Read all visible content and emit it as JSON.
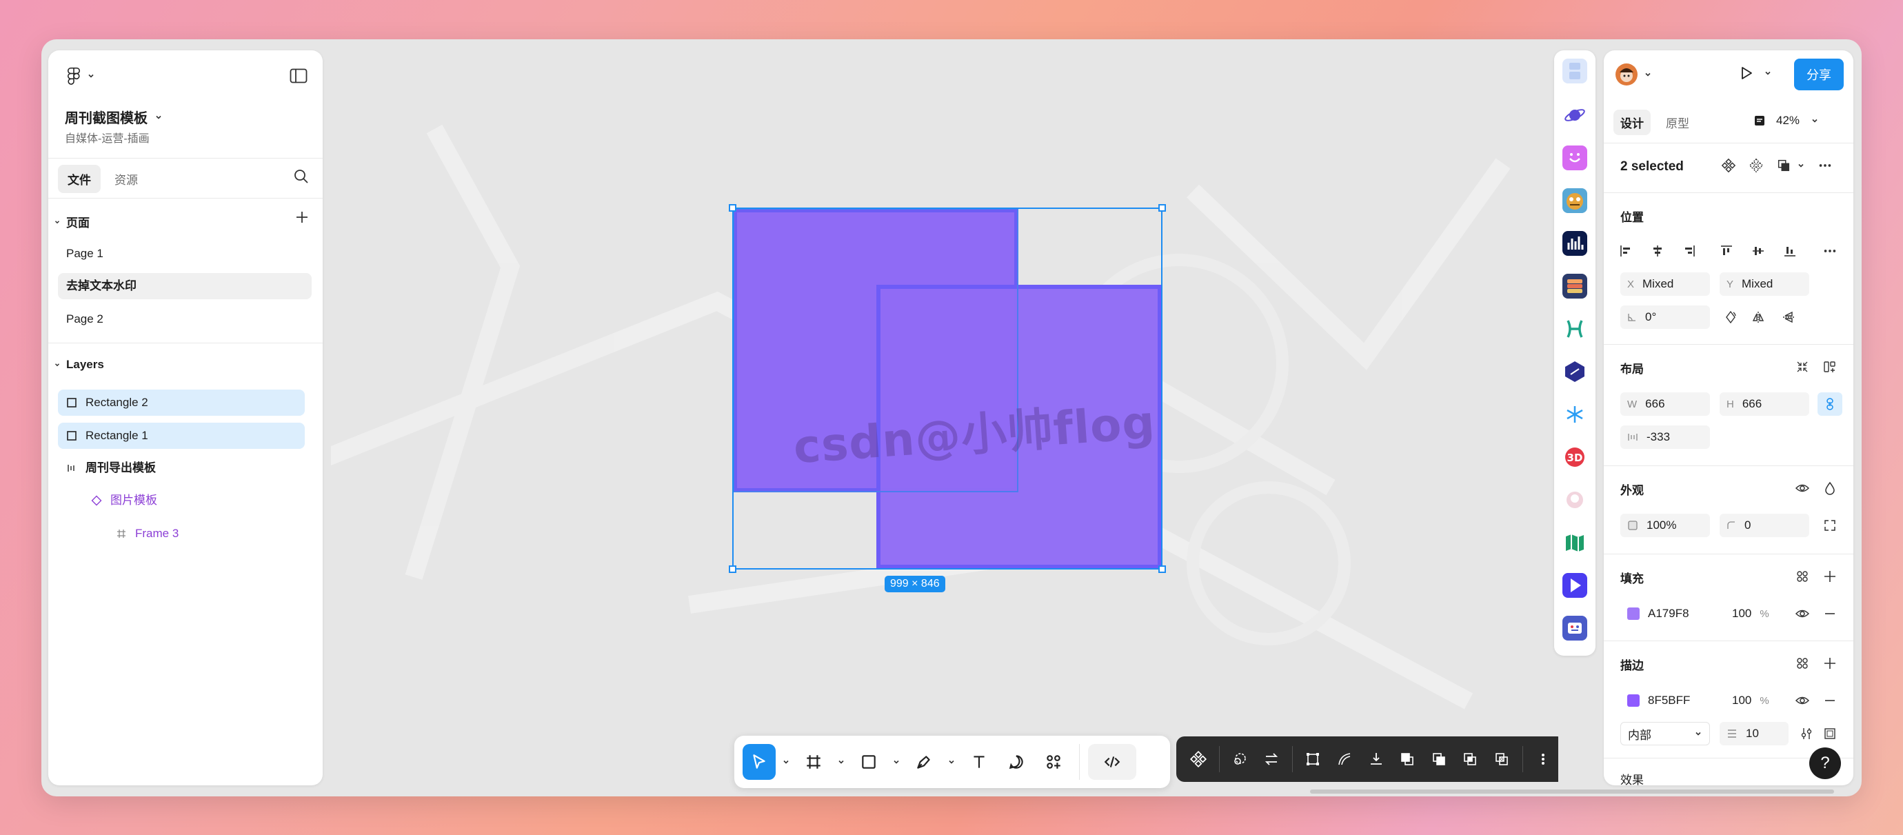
{
  "file": {
    "name": "周刊截图模板",
    "subtitle": "自媒体-运营-插画"
  },
  "left_tabs": {
    "files": "文件",
    "assets": "资源"
  },
  "pages": {
    "header": "页面",
    "items": [
      {
        "label": "Page 1"
      },
      {
        "label": "去掉文本水印"
      },
      {
        "label": "Page 2"
      }
    ]
  },
  "layers": {
    "header": "Layers",
    "items": [
      {
        "label": "Rectangle 2"
      },
      {
        "label": "Rectangle 1"
      },
      {
        "label": "周刊导出模板"
      },
      {
        "label": "图片模板"
      },
      {
        "label": "Frame 3"
      }
    ]
  },
  "canvas": {
    "dimension_badge": "999 × 846",
    "watermark": "csdn@小帅flog",
    "rect_fill": "#8F6BF5",
    "selection_color": "#1A8FF0"
  },
  "right": {
    "share": "分享",
    "tabs": {
      "design": "设计",
      "prototype": "原型"
    },
    "zoom": "42%",
    "selection": "2 selected",
    "position": {
      "title": "位置",
      "x_label": "X",
      "x": "Mixed",
      "y_label": "Y",
      "y": "Mixed",
      "rotation": "0°"
    },
    "layout": {
      "title": "布局",
      "w_label": "W",
      "w": "666",
      "h_label": "H",
      "h": "666",
      "gap": "-333"
    },
    "appearance": {
      "title": "外观",
      "opacity": "100%",
      "radius": "0"
    },
    "fill": {
      "title": "填充",
      "hex": "A179F8",
      "opacity": "100",
      "unit": "%",
      "color": "#A179F8"
    },
    "stroke": {
      "title": "描边",
      "hex": "8F5BFF",
      "opacity": "100",
      "unit": "%",
      "color": "#8F5BFF",
      "position": "内部",
      "width": "10"
    },
    "effects": {
      "title": "效果"
    }
  },
  "help": "?"
}
